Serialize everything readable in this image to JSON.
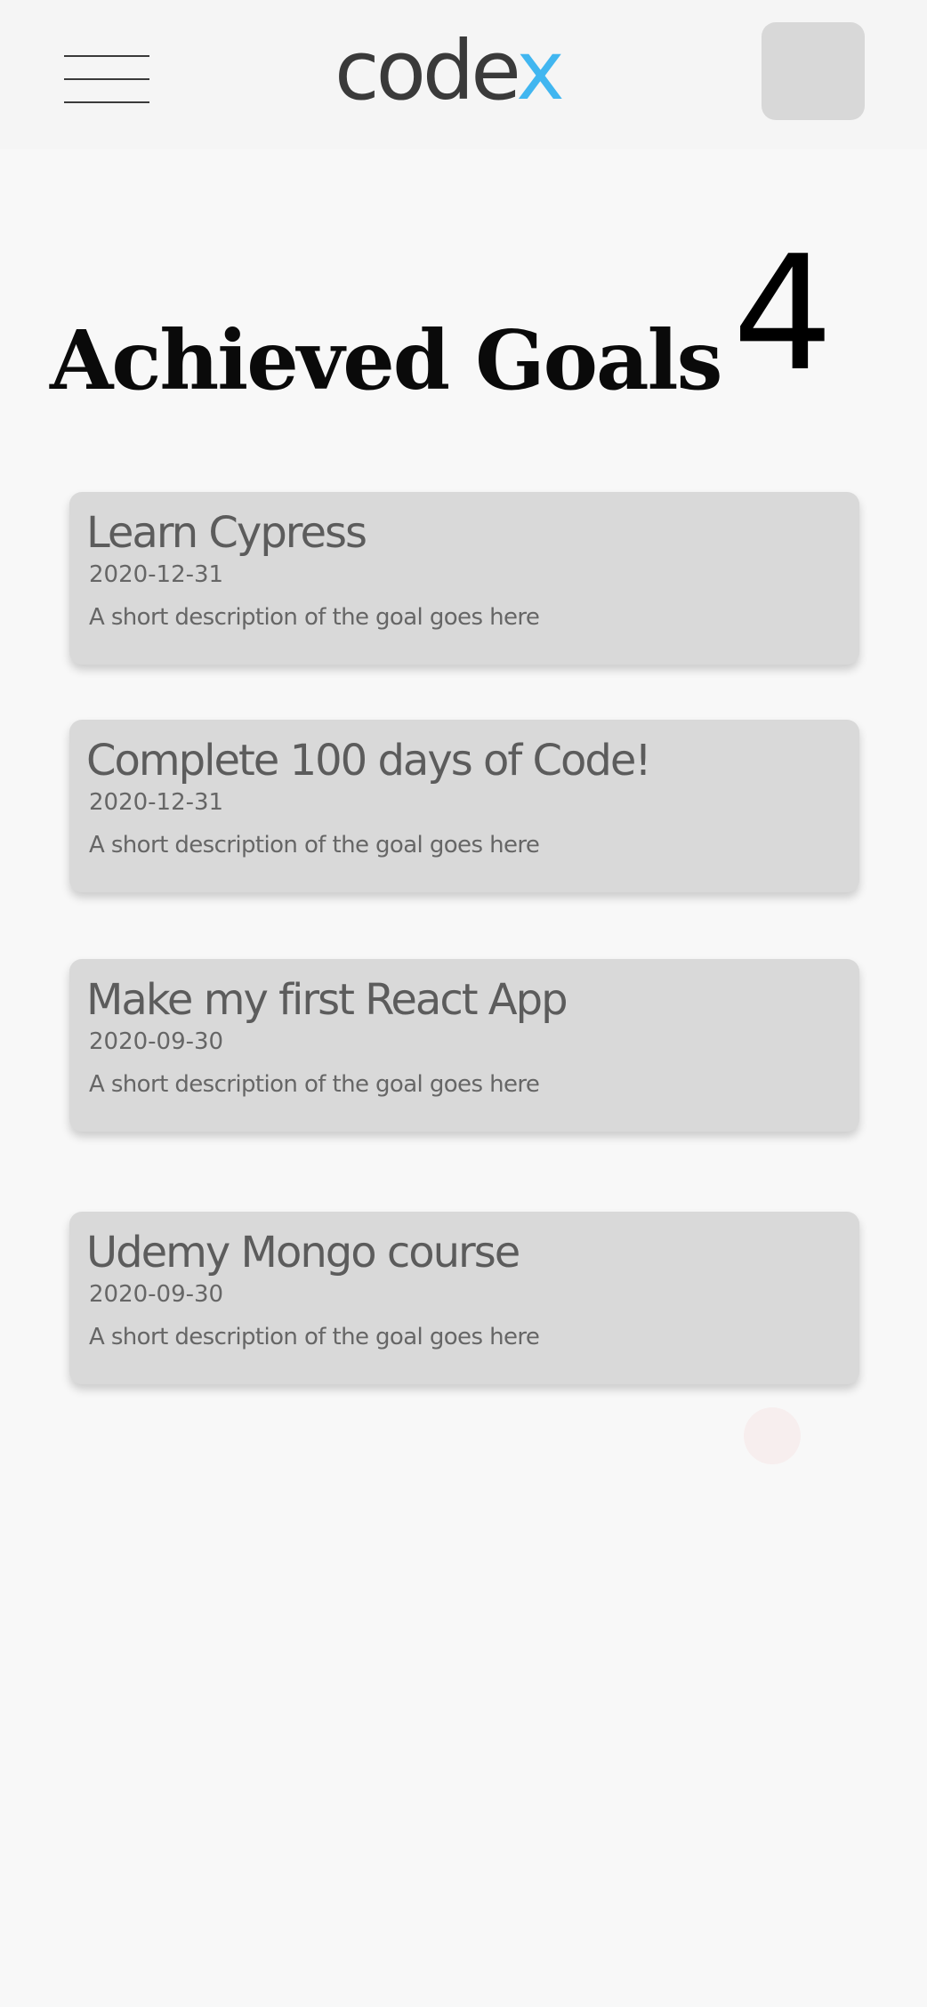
{
  "header": {
    "logo_main": "code",
    "logo_accent": "x"
  },
  "page": {
    "title": "Achieved Goals",
    "count": "4"
  },
  "goals": [
    {
      "title": "Learn Cypress",
      "date": "2020-12-31",
      "description": "A short description of the goal goes here"
    },
    {
      "title": "Complete 100 days of Code!",
      "date": "2020-12-31",
      "description": "A short description of the goal goes here"
    },
    {
      "title": "Make my first React App",
      "date": "2020-09-30",
      "description": "A short description of the goal goes here"
    },
    {
      "title": "Udemy Mongo course",
      "date": "2020-09-30",
      "description": "A short description of the goal goes here"
    }
  ],
  "colors": {
    "logo_accent": "#41b6f0",
    "card_background": "#d9d9d9",
    "page_background": "#f8f8f8"
  },
  "icons": {
    "menu": "hamburger-menu-icon",
    "avatar": "user-avatar-placeholder"
  }
}
